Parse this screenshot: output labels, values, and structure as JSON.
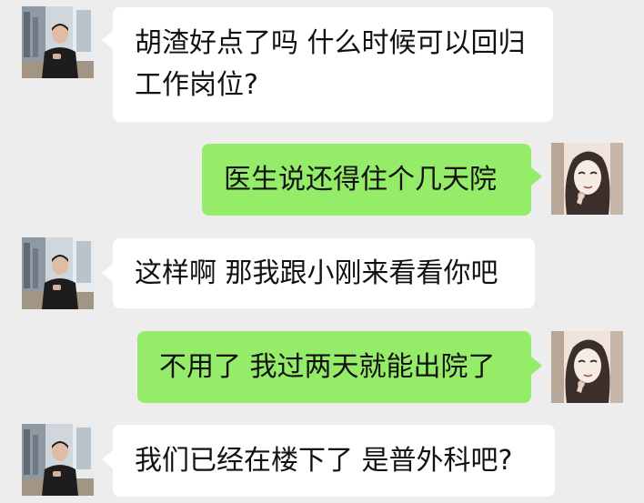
{
  "messages": [
    {
      "side": "received",
      "lines": [
        "胡渣好点了吗 什么时候可以回归",
        "工作岗位?"
      ]
    },
    {
      "side": "sent",
      "text": "医生说还得住个几天院"
    },
    {
      "side": "received",
      "text": "这样啊 那我跟小刚来看看你吧"
    },
    {
      "side": "sent",
      "text": "不用了 我过两天就能出院了"
    },
    {
      "side": "received",
      "text": "我们已经在楼下了 是普外科吧?"
    }
  ],
  "colors": {
    "background": "#ededed",
    "received_bubble": "#ffffff",
    "sent_bubble": "#95ec69",
    "text": "#111111"
  }
}
